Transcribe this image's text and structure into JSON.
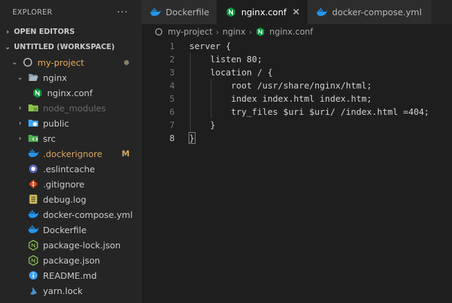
{
  "explorer": {
    "title": "EXPLORER",
    "more_label": "···",
    "open_editors": "OPEN EDITORS",
    "workspace": "UNTITLED (WORKSPACE)",
    "tree": [
      {
        "label": "my-project",
        "badge": "",
        "color": "#e8ab53"
      },
      {
        "label": "nginx",
        "badge": "",
        "color": "#cccccc"
      },
      {
        "label": "nginx.conf",
        "badge": "",
        "color": "#cccccc"
      },
      {
        "label": "node_modules",
        "badge": "",
        "color": "#6a6a6a"
      },
      {
        "label": "public",
        "badge": "",
        "color": "#cccccc"
      },
      {
        "label": "src",
        "badge": "",
        "color": "#cccccc"
      },
      {
        "label": ".dockerignore",
        "badge": "M",
        "color": "#d7a75f"
      },
      {
        "label": ".eslintcache",
        "badge": "",
        "color": "#cccccc"
      },
      {
        "label": ".gitignore",
        "badge": "",
        "color": "#cccccc"
      },
      {
        "label": "debug.log",
        "badge": "",
        "color": "#cccccc"
      },
      {
        "label": "docker-compose.yml",
        "badge": "",
        "color": "#cccccc"
      },
      {
        "label": "Dockerfile",
        "badge": "",
        "color": "#cccccc"
      },
      {
        "label": "package-lock.json",
        "badge": "",
        "color": "#cccccc"
      },
      {
        "label": "package.json",
        "badge": "",
        "color": "#cccccc"
      },
      {
        "label": "README.md",
        "badge": "",
        "color": "#cccccc"
      },
      {
        "label": "yarn.lock",
        "badge": "",
        "color": "#cccccc"
      }
    ]
  },
  "tabs": [
    {
      "label": "Dockerfile",
      "icon": "docker-icon",
      "active": false
    },
    {
      "label": "nginx.conf",
      "icon": "nginx-icon",
      "active": true,
      "close": "✕"
    },
    {
      "label": "docker-compose.yml",
      "icon": "docker-icon",
      "active": false
    }
  ],
  "breadcrumb": [
    "my-project",
    "nginx",
    "nginx.conf"
  ],
  "editor": {
    "line_numbers": [
      "1",
      "2",
      "3",
      "4",
      "5",
      "6",
      "7",
      "8"
    ],
    "current_line": 8,
    "lines": [
      "server {",
      "    listen 80;",
      "    location / {",
      "        root /usr/share/nginx/html;",
      "        index index.html index.htm;",
      "        try_files $uri $uri/ /index.html =404;",
      "    }",
      "}"
    ]
  },
  "colors": {
    "accent_link": "#3794ff",
    "modified": "#d7a75f",
    "nginx_green": "#009639",
    "docker_blue": "#2496ed"
  }
}
